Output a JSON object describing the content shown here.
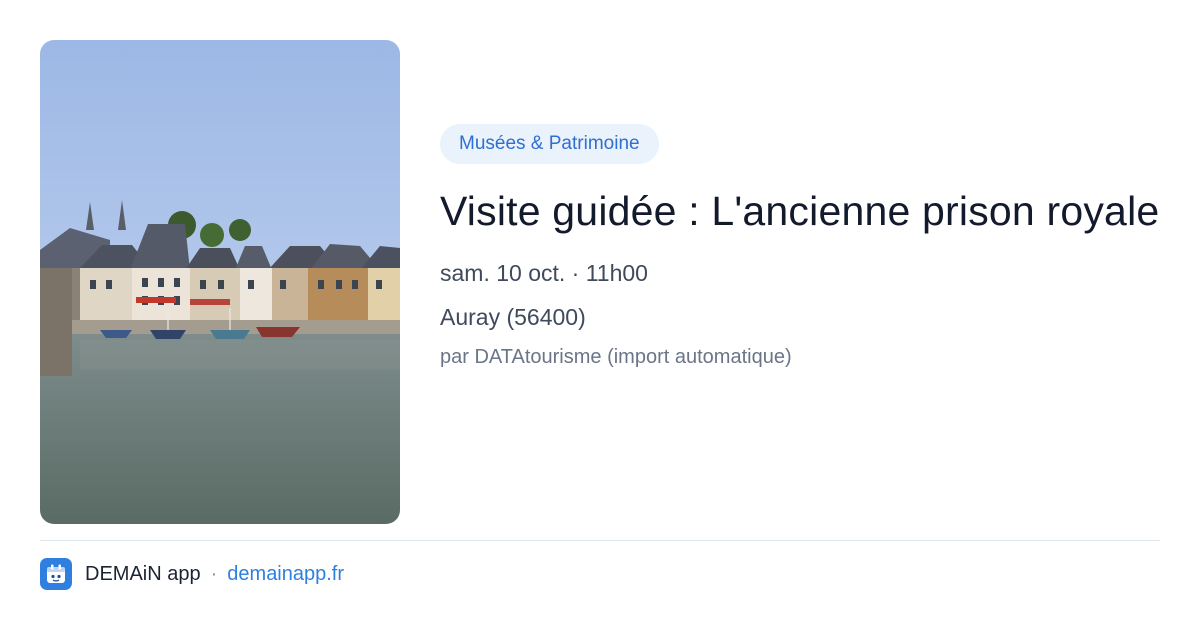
{
  "event": {
    "category": "Musées & Patrimoine",
    "title": "Visite guidée : L'ancienne prison royale",
    "date": "sam. 10 oct. · 11h00",
    "place": "Auray (56400)",
    "source": "par DATAtourisme (import automatique)"
  },
  "footer": {
    "app_name": "DEMAiN app",
    "separator": "·",
    "link": "demainapp.fr"
  },
  "icons": {
    "app_logo": "calendar-app-icon"
  },
  "colors": {
    "accent": "#2f7fe0",
    "badge_bg": "#eaf2fb",
    "title": "#121a2b"
  }
}
